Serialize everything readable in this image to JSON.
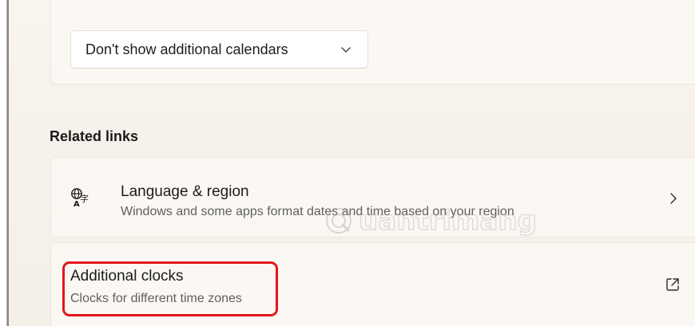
{
  "calendar": {
    "dropdown_value": "Don't show additional calendars"
  },
  "related_links": {
    "title": "Related links",
    "items": [
      {
        "title": "Language & region",
        "subtitle": "Windows and some apps format dates and time based on your region",
        "icon": "language-icon",
        "action_icon": "chevron-right-icon"
      },
      {
        "title": "Additional clocks",
        "subtitle": "Clocks for different time zones",
        "action_icon": "open-external-icon"
      }
    ]
  },
  "watermark": {
    "text": "uantrimang",
    "logo": "Quantrimang watermark"
  },
  "colors": {
    "background": "#f6f2ec",
    "card": "#fbf8f4",
    "highlight": "#e3161b",
    "text_primary": "#1b1b1b",
    "text_secondary": "#5f5f5f"
  }
}
